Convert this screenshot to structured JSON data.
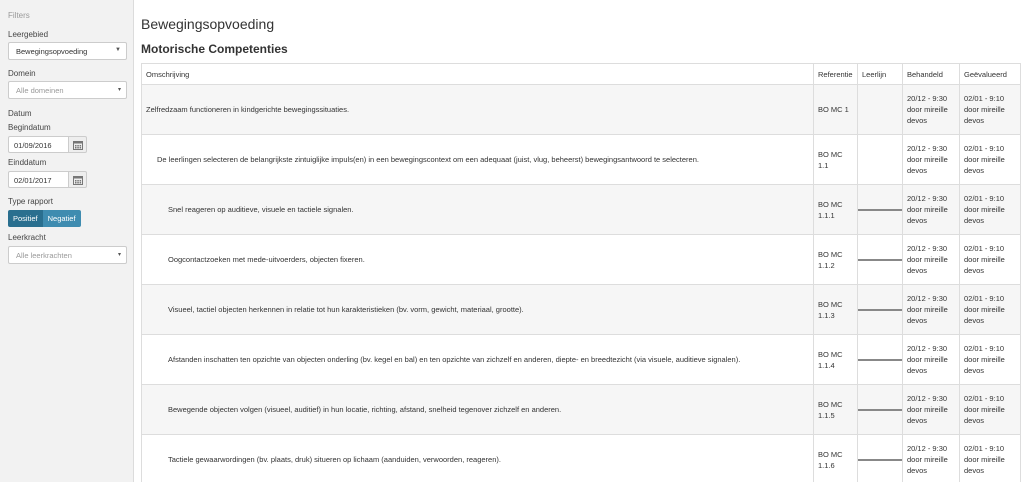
{
  "sidebar": {
    "header": "Filters",
    "leergebied": {
      "label": "Leergebied",
      "value": "Bewegingsopvoeding"
    },
    "domein": {
      "label": "Domein",
      "placeholder": "Alle domeinen"
    },
    "datum": {
      "label": "Datum"
    },
    "begindatum": {
      "label": "Begindatum",
      "value": "01/09/2016"
    },
    "einddatum": {
      "label": "Einddatum",
      "value": "02/01/2017"
    },
    "type_rapport": {
      "label": "Type rapport",
      "options": [
        "Positief",
        "Negatief"
      ],
      "selected": "Positief"
    },
    "leerkracht": {
      "label": "Leerkracht",
      "placeholder": "Alle leerkrachten"
    }
  },
  "main": {
    "title": "Bewegingsopvoeding",
    "section": "Motorische Competenties",
    "columns": [
      "Omschrijving",
      "Referentie",
      "Leerlijn",
      "Behandeld",
      "Geëvalueerd"
    ],
    "rows": [
      {
        "level": 0,
        "omschrijving": "Zelfredzaam functioneren in kindgerichte bewegingssituaties.",
        "ref1": "BO MC 1",
        "ref2": "",
        "leerlijn": false,
        "behandeld": [
          "20/12 - 9:30",
          "door mireille",
          "devos"
        ],
        "geevalueerd": [
          "02/01 - 9:10",
          "door mireille",
          "devos"
        ]
      },
      {
        "level": 1,
        "omschrijving": "De leerlingen selecteren de belangrijkste zintuiglijke impuls(en) in een bewegingscontext om een adequaat (juist, vlug, beheerst) bewegingsantwoord te selecteren.",
        "ref1": "BO MC",
        "ref2": "1.1",
        "leerlijn": false,
        "behandeld": [
          "20/12 - 9:30",
          "door mireille",
          "devos"
        ],
        "geevalueerd": [
          "02/01 - 9:10",
          "door mireille",
          "devos"
        ]
      },
      {
        "level": 2,
        "omschrijving": "Snel reageren op auditieve, visuele en tactiele signalen.",
        "ref1": "BO MC",
        "ref2": "1.1.1",
        "leerlijn": true,
        "behandeld": [
          "20/12 - 9:30",
          "door mireille",
          "devos"
        ],
        "geevalueerd": [
          "02/01 - 9:10",
          "door mireille",
          "devos"
        ]
      },
      {
        "level": 2,
        "omschrijving": "Oogcontactzoeken met mede-uitvoerders, objecten fixeren.",
        "ref1": "BO MC",
        "ref2": "1.1.2",
        "leerlijn": true,
        "behandeld": [
          "20/12 - 9:30",
          "door mireille",
          "devos"
        ],
        "geevalueerd": [
          "02/01 - 9:10",
          "door mireille",
          "devos"
        ]
      },
      {
        "level": 2,
        "omschrijving": "Visueel, tactiel objecten herkennen in relatie tot hun karakteristieken (bv. vorm, gewicht, materiaal, grootte).",
        "ref1": "BO MC",
        "ref2": "1.1.3",
        "leerlijn": true,
        "behandeld": [
          "20/12 - 9:30",
          "door mireille",
          "devos"
        ],
        "geevalueerd": [
          "02/01 - 9:10",
          "door mireille",
          "devos"
        ]
      },
      {
        "level": 2,
        "omschrijving": "Afstanden inschatten ten opzichte van objecten onderling (bv. kegel en bal) en ten opzichte van zichzelf en anderen, diepte- en breedtezicht (via visuele, auditieve signalen).",
        "ref1": "BO MC",
        "ref2": "1.1.4",
        "leerlijn": true,
        "behandeld": [
          "20/12 - 9:30",
          "door mireille",
          "devos"
        ],
        "geevalueerd": [
          "02/01 - 9:10",
          "door mireille",
          "devos"
        ]
      },
      {
        "level": 2,
        "omschrijving": "Bewegende objecten volgen (visueel, auditief) in hun locatie, richting, afstand, snelheid tegenover zichzelf en anderen.",
        "ref1": "BO MC",
        "ref2": "1.1.5",
        "leerlijn": true,
        "behandeld": [
          "20/12 - 9:30",
          "door mireille",
          "devos"
        ],
        "geevalueerd": [
          "02/01 - 9:10",
          "door mireille",
          "devos"
        ]
      },
      {
        "level": 2,
        "omschrijving": "Tactiele gewaarwordingen (bv. plaats, druk) situeren op lichaam (aanduiden, verwoorden, reageren).",
        "ref1": "BO MC",
        "ref2": "1.1.6",
        "leerlijn": true,
        "behandeld": [
          "20/12 - 9:30",
          "door mireille",
          "devos"
        ],
        "geevalueerd": [
          "02/01 - 9:10",
          "door mireille",
          "devos"
        ]
      }
    ]
  },
  "icons": {
    "calendar": "calendar-icon",
    "caret": "caret-down-icon"
  }
}
